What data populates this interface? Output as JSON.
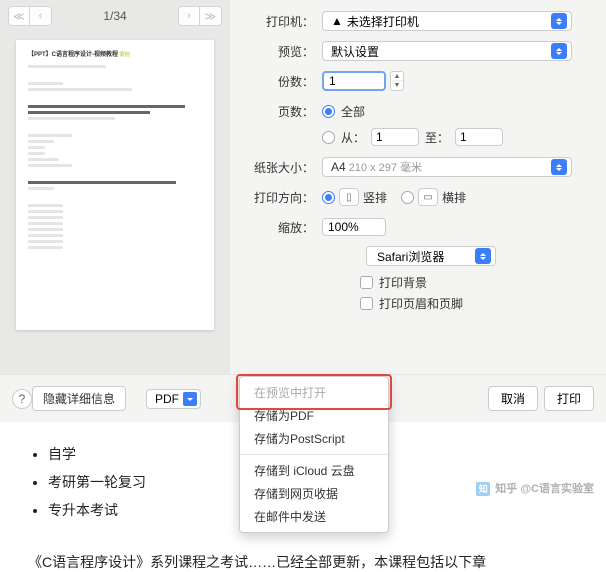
{
  "preview": {
    "page_counter": "1/34",
    "doc_title": "【PPT】C语言程序设计-视频教程",
    "doc_badge": "原创"
  },
  "print": {
    "printer_label": "打印机：",
    "printer_value": "未选择打印机",
    "preset_label": "预览：",
    "preset_value": "默认设置",
    "copies_label": "份数：",
    "copies_value": "1",
    "pages_label": "页数：",
    "pages_all": "全部",
    "pages_from_label": "从：",
    "pages_from_value": "1",
    "pages_to_label": "至：",
    "pages_to_value": "1",
    "paper_label": "纸张大小：",
    "paper_value": "A4",
    "paper_dim": "210 x 297 毫米",
    "orient_label": "打印方向：",
    "orient_portrait": "竖排",
    "orient_landscape": "横排",
    "scale_label": "缩放：",
    "scale_value": "100%",
    "app_name": "Safari浏览器",
    "print_bg": "打印背景",
    "print_headers": "打印页眉和页脚"
  },
  "footer": {
    "help": "?",
    "hide_details": "隐藏详细信息",
    "pdf_label": "PDF",
    "cancel": "取消",
    "print": "打印"
  },
  "pdf_menu": {
    "open_in_preview": "在预览中打开",
    "save_as_pdf": "存储为PDF",
    "save_as_ps": "存储为PostScript",
    "save_icloud": "存储到 iCloud 云盘",
    "save_web": "存储到网页收据",
    "send_mail": "在邮件中发送"
  },
  "page": {
    "li1": "自学",
    "li2": "考研第一轮复习",
    "li3": "专升本考试",
    "bottom": "《C语言程序设计》系列课程之考试……已经全部更新，本课程包括以下章"
  },
  "watermark": "知乎 @C语言实验室"
}
